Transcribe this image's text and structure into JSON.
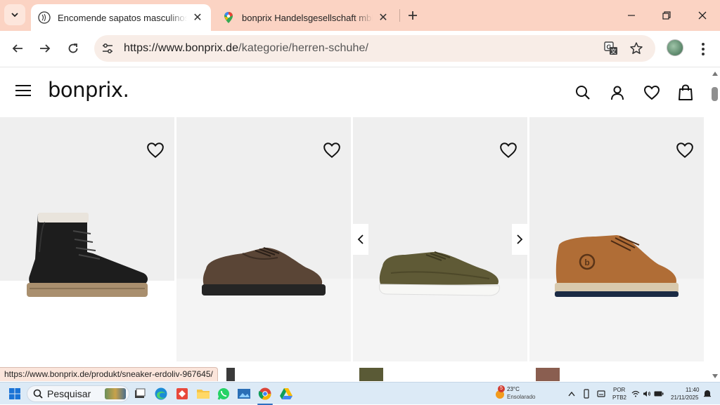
{
  "browser": {
    "tabs": [
      {
        "title": "Encomende sapatos masculinos de",
        "active": true,
        "favicon": "bonprix-favicon"
      },
      {
        "title": "bonprix Handelsgesellschaft mbH",
        "active": false,
        "favicon": "google-maps-pin"
      }
    ],
    "url_domain": "https://www.bonprix.de",
    "url_path": "/kategorie/herren-schuhe/",
    "status_url": "https://www.bonprix.de/produkt/sneaker-erdoliv-967645/"
  },
  "site": {
    "logo": "bonprix."
  },
  "products": [
    {
      "type": "black winter boot",
      "swatch_color": "#2a2a2a"
    },
    {
      "type": "brown lace-up shoe",
      "swatch_color": "#3a3a3a"
    },
    {
      "type": "olive sneaker",
      "swatch_color": "#5a5a36"
    },
    {
      "type": "cognac high sneaker",
      "swatch_color": "#8a5e50"
    }
  ],
  "taskbar": {
    "search_placeholder": "Pesquisar",
    "weather_temp": "23°C",
    "weather_desc": "Ensolarado",
    "weather_badge": "5",
    "lang_top": "POR",
    "lang_bottom": "PTB2",
    "time": "11:40",
    "date": "21/11/2025"
  },
  "colors": {
    "tabbar": "#fbd3c3",
    "omnibox": "#f8ede7",
    "taskbar": "#dceaf6"
  }
}
